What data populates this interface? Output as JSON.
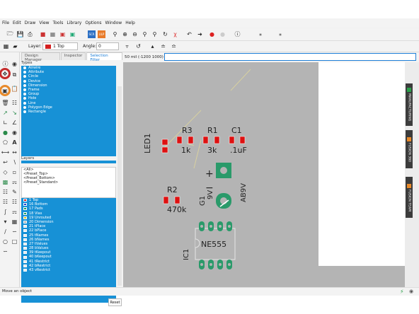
{
  "menu": [
    "File",
    "Edit",
    "Draw",
    "View",
    "Tools",
    "Library",
    "Options",
    "Window",
    "Help"
  ],
  "toolbar2": {
    "layer_label": "Layer:",
    "layer_value": "1 Top",
    "angle_label": "Angle:",
    "angle_value": "0",
    "grid_readout": "50 mil (-1200 1000)"
  },
  "tabs": [
    "Design Manager",
    "Inspector",
    "Selection Filter"
  ],
  "types_label": "Types",
  "types": [
    "Airwire",
    "Attribute",
    "Circle",
    "Device",
    "Dimension",
    "Frame",
    "Group",
    "Hole",
    "Line",
    "Polygon Edge",
    "Rectangle"
  ],
  "layers_label": "Layers",
  "presets": [
    "<All>",
    "<Preset_Top>",
    "<Preset_Bottom>",
    "<Preset_Standard>"
  ],
  "layers": [
    {
      "name": "1 Top",
      "color": "#d42020"
    },
    {
      "name": "16 Bottom",
      "color": "#2040d0"
    },
    {
      "name": "17 Pads",
      "color": "#20a060"
    },
    {
      "name": "18 Vias",
      "color": "#20a060"
    },
    {
      "name": "19 Unrouted",
      "color": "#d8c020"
    },
    {
      "name": "20 Dimension",
      "color": "#b0b0b0"
    },
    {
      "name": "21 tPlace",
      "color": "#e8e8e8"
    },
    {
      "name": "22 bPlace",
      "color": "#e8e8e8"
    },
    {
      "name": "25 tNames",
      "color": "#e8e8e8"
    },
    {
      "name": "26 bNames",
      "color": "#e8e8e8"
    },
    {
      "name": "27 tValues",
      "color": "#e8e8e8"
    },
    {
      "name": "28 bValues",
      "color": "#e8e8e8"
    },
    {
      "name": "39 tKeepout",
      "color": "#e8e8e8"
    },
    {
      "name": "40 bKeepout",
      "color": "#e8e8e8"
    },
    {
      "name": "41 tRestrict",
      "color": "#e8e8e8"
    },
    {
      "name": "42 bRestrict",
      "color": "#e8e8e8"
    },
    {
      "name": "43 vRestrict",
      "color": "#e8e8e8"
    }
  ],
  "reset_label": "Reset",
  "status": "Move an object",
  "parts": {
    "r3": "R3",
    "r3v": "1k",
    "r1": "R1",
    "r1v": "3k",
    "c1": "C1",
    "c1v": ".1uF",
    "led1": "LED1",
    "r2": "R2",
    "r2v": "470k",
    "g1": "G1",
    "g1v": "9V",
    "ab9v": "AB9V",
    "ic1": "IC1",
    "ne555": "NE555"
  },
  "side_tabs": [
    "MANUFACTURING",
    "FUSION 360",
    "FUSION TEAM"
  ]
}
